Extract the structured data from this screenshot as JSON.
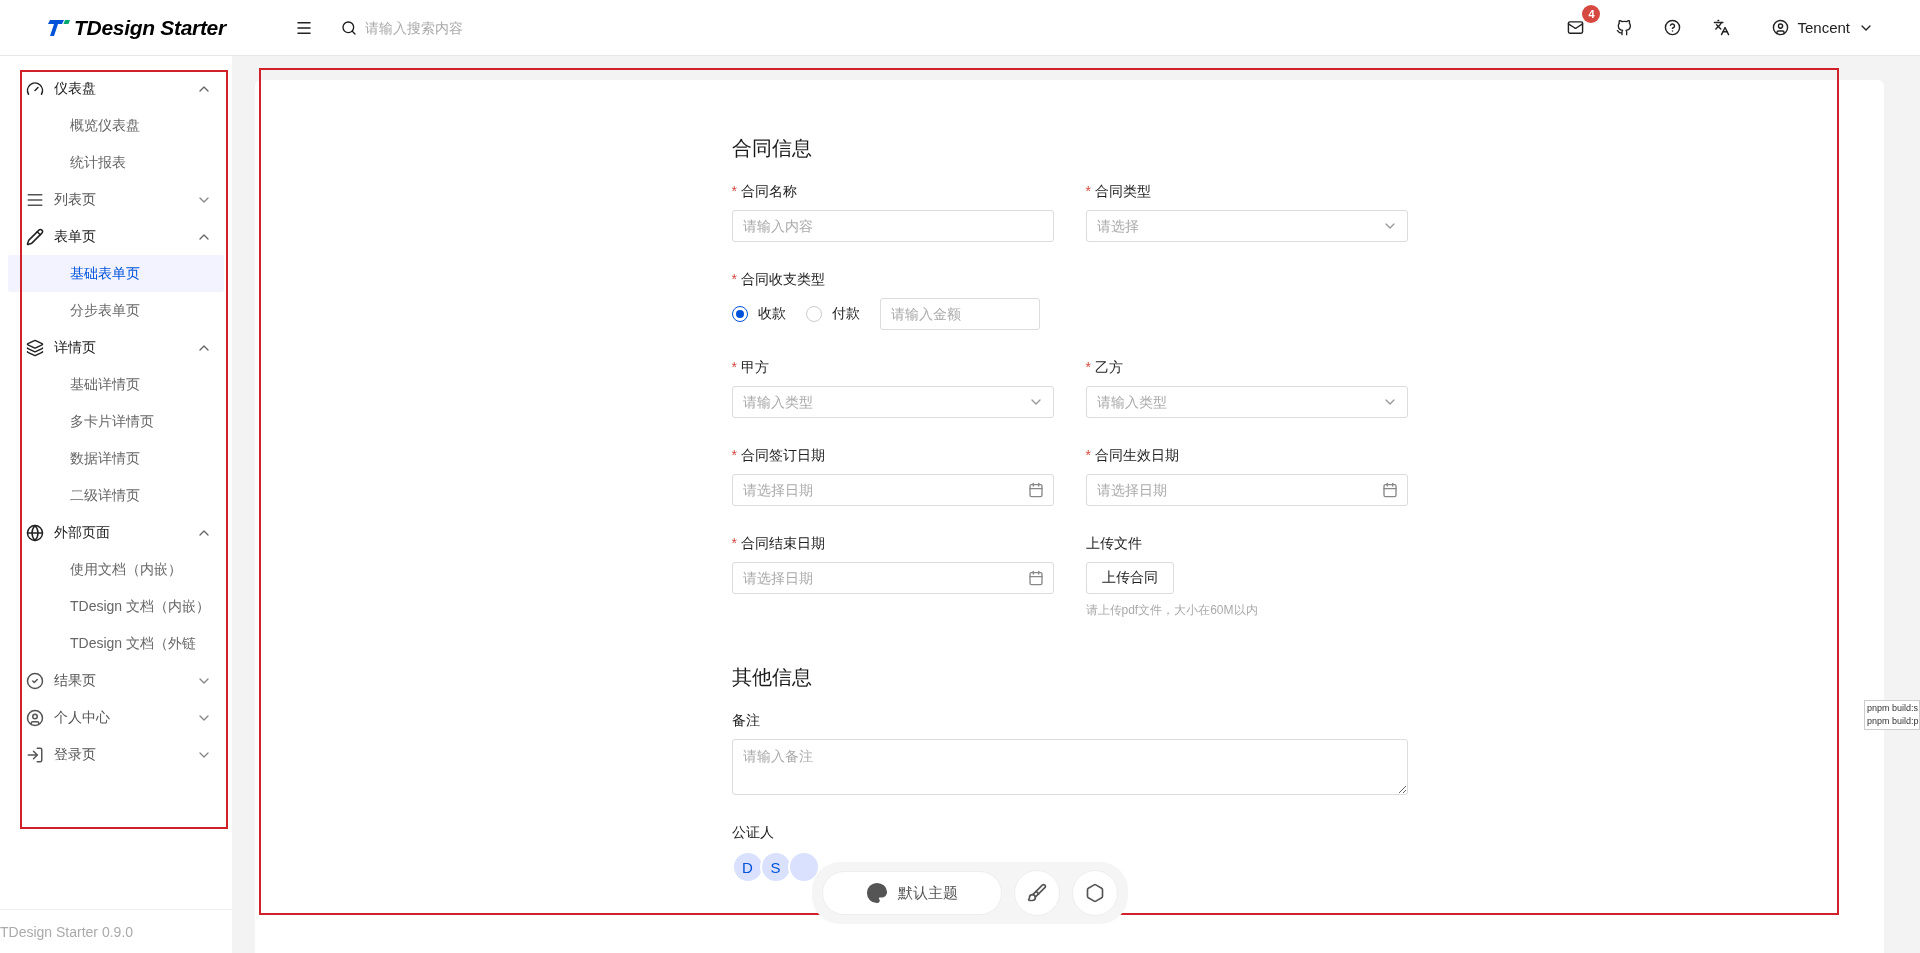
{
  "header": {
    "logo": "TDesign Starter",
    "search": {
      "placeholder": "请输入搜索内容"
    },
    "notice_count": "4",
    "user": "Tencent"
  },
  "sidebar": {
    "items": [
      {
        "label": "仪表盘",
        "kind": "dashboard",
        "expanded": true,
        "children": [
          {
            "label": "概览仪表盘",
            "selected": false
          },
          {
            "label": "统计报表",
            "selected": false
          }
        ]
      },
      {
        "label": "列表页",
        "kind": "list",
        "expanded": false
      },
      {
        "label": "表单页",
        "kind": "form",
        "expanded": true,
        "children": [
          {
            "label": "基础表单页",
            "selected": true
          },
          {
            "label": "分步表单页",
            "selected": false
          }
        ]
      },
      {
        "label": "详情页",
        "kind": "detail",
        "expanded": true,
        "children": [
          {
            "label": "基础详情页",
            "selected": false
          },
          {
            "label": "多卡片详情页",
            "selected": false
          },
          {
            "label": "数据详情页",
            "selected": false
          },
          {
            "label": "二级详情页",
            "selected": false
          }
        ]
      },
      {
        "label": "外部页面",
        "kind": "external",
        "expanded": true,
        "children": [
          {
            "label": "使用文档（内嵌）",
            "selected": false
          },
          {
            "label": "TDesign 文档（内嵌）",
            "selected": false
          },
          {
            "label": "TDesign 文档（外链",
            "selected": false
          }
        ]
      },
      {
        "label": "结果页",
        "kind": "result",
        "expanded": false
      },
      {
        "label": "个人中心",
        "kind": "user",
        "expanded": false
      },
      {
        "label": "登录页",
        "kind": "login",
        "expanded": false
      }
    ],
    "footer": "TDesign Starter 0.9.0"
  },
  "form": {
    "required_mark": "*",
    "sections": [
      {
        "title": "合同信息",
        "fields": [
          {
            "kind": "text",
            "label": "合同名称",
            "required": true,
            "placeholder": "请输入内容"
          },
          {
            "kind": "select",
            "label": "合同类型",
            "required": true,
            "placeholder": "请选择"
          },
          {
            "kind": "radio",
            "label": "合同收支类型",
            "required": true,
            "options": [
              {
                "label": "收款",
                "selected": true
              },
              {
                "label": "付款",
                "selected": false
              }
            ],
            "amount_placeholder": "请输入金额"
          },
          {
            "kind": "select",
            "label": "甲方",
            "required": true,
            "placeholder": "请输入类型"
          },
          {
            "kind": "select",
            "label": "乙方",
            "required": true,
            "placeholder": "请输入类型"
          },
          {
            "kind": "date",
            "label": "合同签订日期",
            "required": true,
            "placeholder": "请选择日期"
          },
          {
            "kind": "date",
            "label": "合同生效日期",
            "required": true,
            "placeholder": "请选择日期"
          },
          {
            "kind": "date",
            "label": "合同结束日期",
            "required": true,
            "placeholder": "请选择日期"
          },
          {
            "kind": "upload",
            "label": "上传文件",
            "required": false,
            "button": "上传合同",
            "hint": "请上传pdf文件，大小在60M以内"
          }
        ]
      },
      {
        "title": "其他信息",
        "fields": [
          {
            "kind": "textarea",
            "label": "备注",
            "required": false,
            "placeholder": "请输入备注"
          },
          {
            "kind": "avatars",
            "label": "公证人",
            "required": false,
            "avatars": [
              "D",
              "S"
            ],
            "covered_avatar": true
          }
        ]
      }
    ]
  },
  "theme_bar": {
    "theme": "默认主题"
  },
  "side_tooltip": [
    "pnpm build:s",
    "pnpm build:p"
  ]
}
